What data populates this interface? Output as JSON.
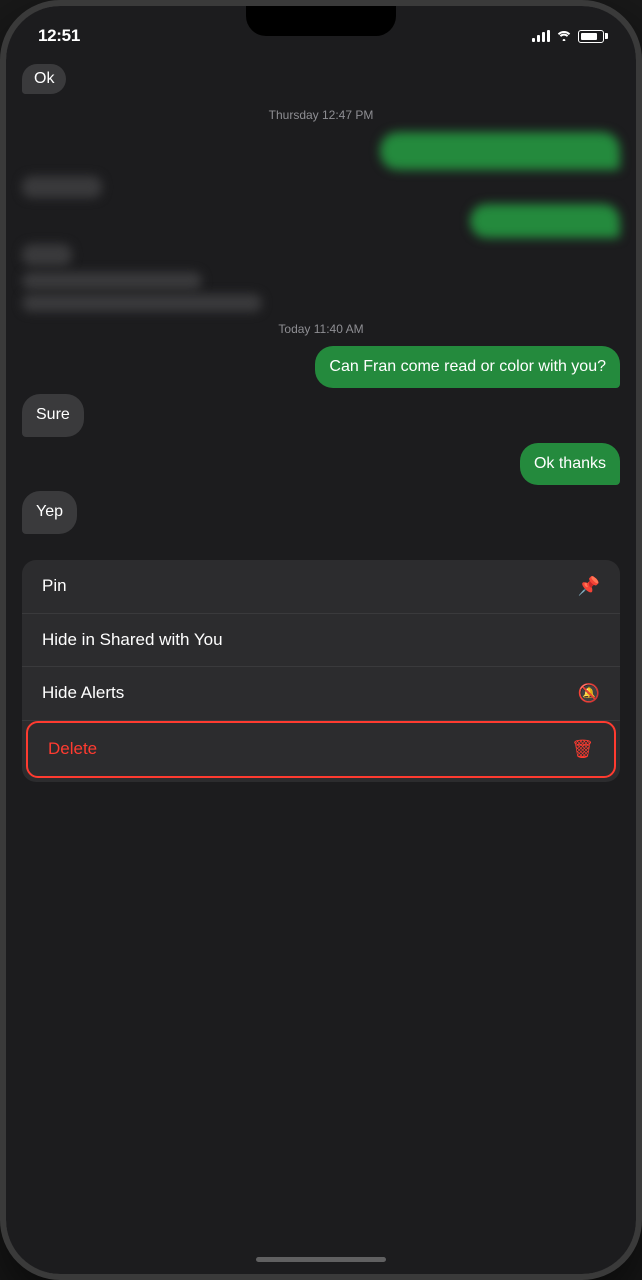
{
  "status_bar": {
    "time": "12:51",
    "signal_bars": 3,
    "wifi": true,
    "battery_level": 80
  },
  "chat": {
    "timestamp_1": "Thursday 12:47 PM",
    "timestamp_2": "Today 11:40 AM",
    "messages": [
      {
        "id": "m1",
        "type": "outgoing_blurred",
        "sender": "me"
      },
      {
        "id": "m2",
        "type": "incoming_blurred",
        "sender": "other"
      },
      {
        "id": "m3",
        "type": "outgoing_blurred_small",
        "sender": "me"
      },
      {
        "id": "m4",
        "type": "incoming_blurred_small",
        "sender": "other"
      },
      {
        "id": "m5",
        "type": "incoming_blurred_medium",
        "sender": "other"
      },
      {
        "id": "m6",
        "type": "outgoing_blurred_multi",
        "sender": "me"
      },
      {
        "id": "m7",
        "type": "outgoing",
        "sender": "me",
        "text": "Can Fran come read or color with you?"
      },
      {
        "id": "m8",
        "type": "incoming",
        "sender": "other",
        "text": "Sure"
      },
      {
        "id": "m9",
        "type": "outgoing",
        "sender": "me",
        "text": "Ok thanks"
      },
      {
        "id": "m10",
        "type": "incoming",
        "sender": "other",
        "text": "Yep"
      }
    ]
  },
  "context_menu": {
    "items": [
      {
        "id": "pin",
        "label": "Pin",
        "icon": "📌",
        "style": "normal"
      },
      {
        "id": "hide-shared",
        "label": "Hide in Shared with You",
        "icon": "",
        "style": "normal"
      },
      {
        "id": "hide-alerts",
        "label": "Hide Alerts",
        "icon": "🔕",
        "style": "normal"
      },
      {
        "id": "delete",
        "label": "Delete",
        "icon": "🗑",
        "style": "delete"
      }
    ]
  }
}
